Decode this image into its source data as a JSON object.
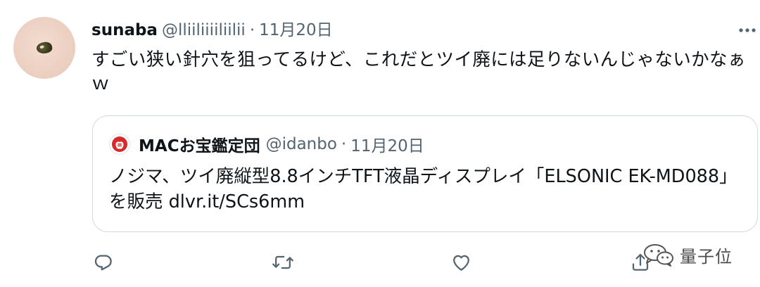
{
  "tweet": {
    "author": {
      "display_name": "sunaba",
      "handle": "@lliiliiiiliilii"
    },
    "separator": "·",
    "timestamp": "11月20日",
    "text": "すごい狭い針穴を狙ってるけど、これだとツイ廃には足りないんじゃないかなぁｗ"
  },
  "quoted_tweet": {
    "author": {
      "display_name": "MACお宝鑑定団",
      "handle": "@idanbo"
    },
    "separator": "·",
    "timestamp": "11月20日",
    "text": "ノジマ、ツイ廃縦型8.8インチTFT液晶ディスプレイ「ELSONIC EK-MD088」を販売 dlvr.it/SCs6mm"
  },
  "actions": [
    {
      "name": "reply",
      "icon": "reply-icon"
    },
    {
      "name": "retweet",
      "icon": "retweet-icon"
    },
    {
      "name": "like",
      "icon": "heart-icon"
    },
    {
      "name": "share",
      "icon": "share-icon"
    }
  ],
  "watermark": {
    "text": "量子位"
  },
  "colors": {
    "text_primary": "#0f1419",
    "text_secondary": "#536471",
    "border": "#cfd9de",
    "quote_avatar_red": "#d72b2b"
  }
}
